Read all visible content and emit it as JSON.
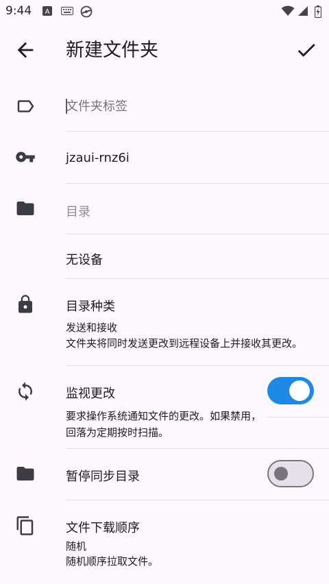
{
  "status_bar": {
    "time": "9:44",
    "icons": [
      "a-icon",
      "keyboard-icon",
      "sync-globe-icon",
      "wifi-icon",
      "signal-icon",
      "battery-icon"
    ]
  },
  "appbar": {
    "title": "新建文件夹"
  },
  "fields": {
    "label": {
      "value": "",
      "placeholder": "文件夹标签"
    },
    "folder_id": {
      "value": "jzaui-rnz6i"
    },
    "directory": {
      "value": "",
      "placeholder": "目录"
    },
    "device": {
      "value": "无设备"
    }
  },
  "settings": {
    "folder_type": {
      "title": "目录种类",
      "value": "发送和接收",
      "description": "文件夹将同时发送更改到远程设备上并接收其更改。"
    },
    "watch_changes": {
      "title": "监视更改",
      "description_line1": "要求操作系统通知文件的更改。如果禁用，",
      "description_line2": "回落为定期按时扫描。",
      "enabled": true
    },
    "pause_sync": {
      "title": "暂停同步目录",
      "enabled": false
    },
    "pull_order": {
      "title": "文件下载顺序",
      "value": "随机",
      "description": "随机顺序拉取文件。"
    }
  },
  "colors": {
    "background": "#fcf8fd",
    "accent": "#1e88e5",
    "icon": "#3c3c44"
  }
}
